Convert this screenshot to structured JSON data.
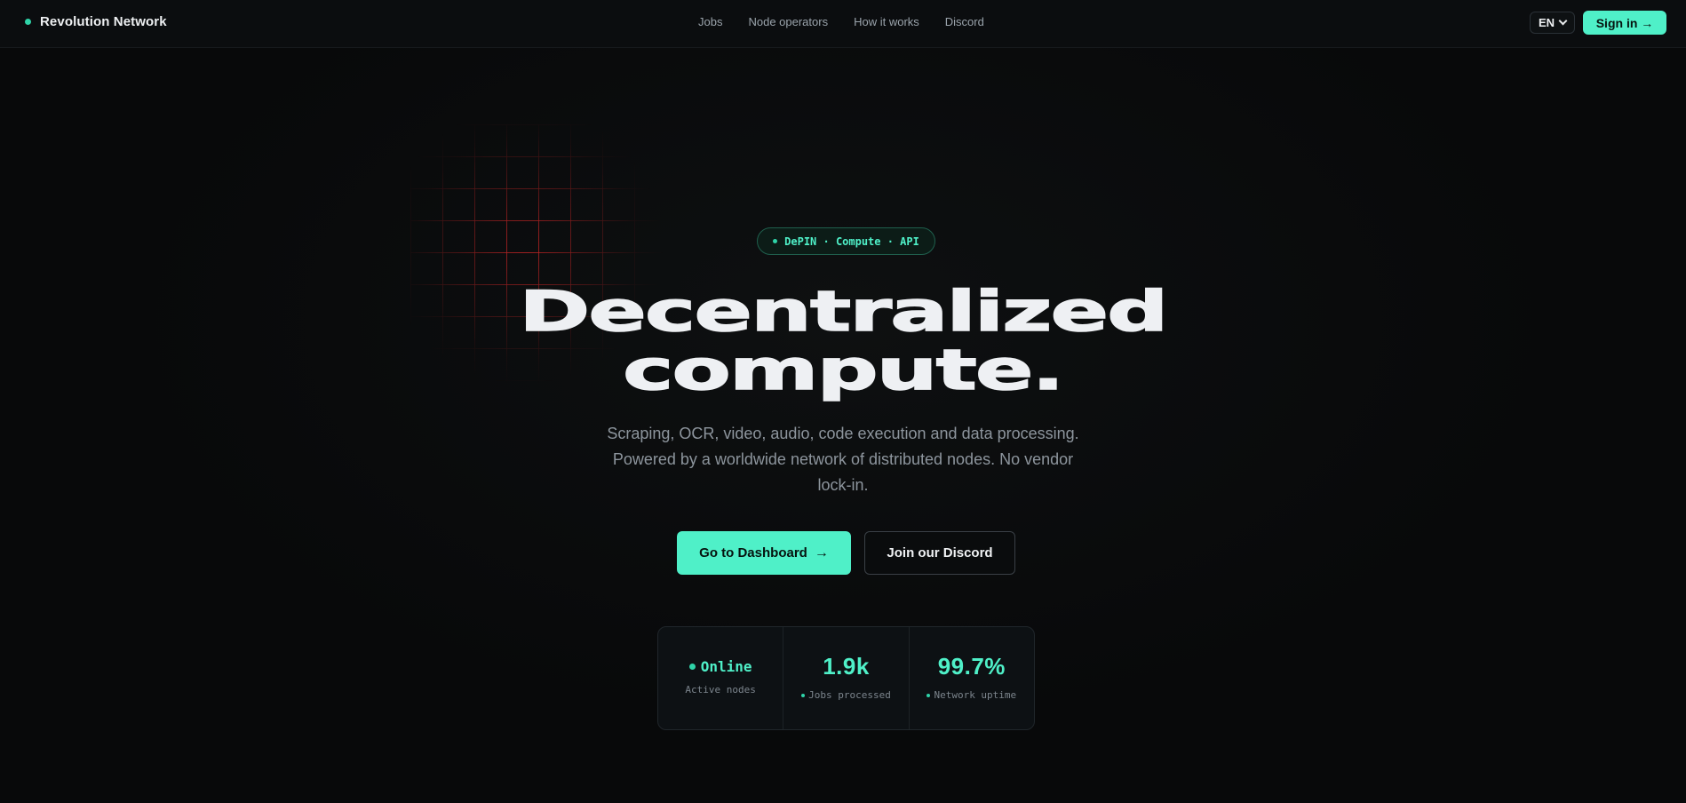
{
  "header": {
    "brand": "Revolution Network",
    "nav": [
      "Jobs",
      "Node operators",
      "How it works",
      "Discord"
    ],
    "language": "EN",
    "signin_label": "Sign in →"
  },
  "hero": {
    "badge": "DePIN · Compute · API",
    "headline_line1": "Decentralized",
    "headline_line2": "compute.",
    "subtitle": "Scraping, OCR, video, audio, code execution and data processing. Powered by a worldwide network of distributed nodes. No vendor lock-in.",
    "primary_cta": "Go to Dashboard",
    "primary_cta_arrow": "→",
    "secondary_cta": "Join our Discord"
  },
  "stats": [
    {
      "value": "Online",
      "label": "Active nodes"
    },
    {
      "value": "1.9k",
      "label": "Jobs processed"
    },
    {
      "value": "99.7%",
      "label": "Network uptime"
    }
  ],
  "colors": {
    "accent": "#4ff0c8",
    "background": "#08090a",
    "grid": "#ff2d2d"
  }
}
